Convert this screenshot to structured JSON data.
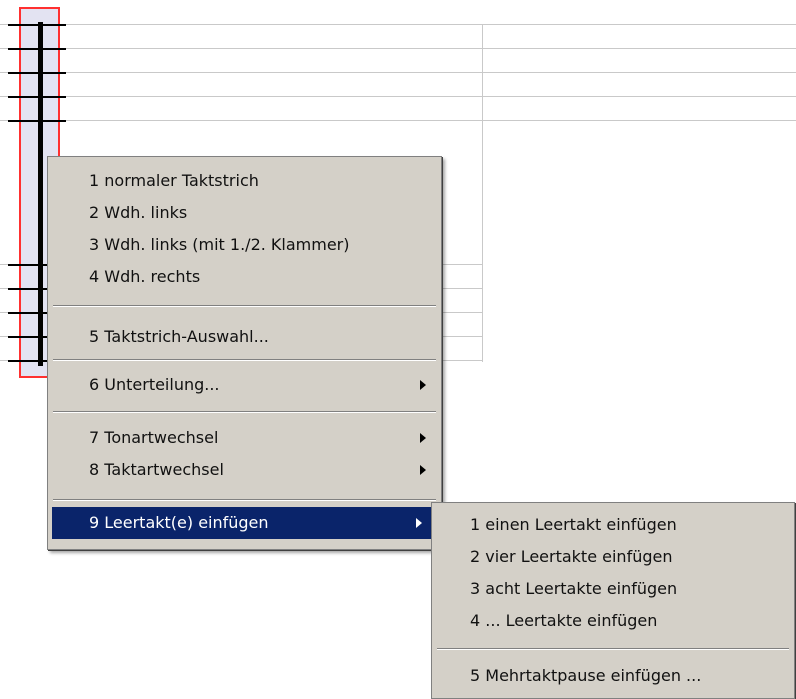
{
  "main_menu": {
    "items": [
      {
        "label": "1 normaler Taktstrich"
      },
      {
        "label": "2 Wdh. links"
      },
      {
        "label": "3 Wdh. links (mit 1./2. Klammer)"
      },
      {
        "label": "4 Wdh. rechts"
      },
      {
        "label": "5 Taktstrich-Auswahl..."
      },
      {
        "label": "6 Unterteilung..."
      },
      {
        "label": "7 Tonartwechsel"
      },
      {
        "label": "8 Taktartwechsel"
      },
      {
        "label": "9 Leertakt(e) einfügen"
      }
    ]
  },
  "submenu": {
    "items": [
      {
        "label": "1 einen Leertakt einfügen"
      },
      {
        "label": "2 vier Leertakte einfügen"
      },
      {
        "label": "3 acht Leertakte einfügen"
      },
      {
        "label": "4 ... Leertakte einfügen"
      },
      {
        "label": "5 Mehrtaktpause einfügen ..."
      }
    ]
  },
  "colors": {
    "menu_bg": "#d4d0c8",
    "highlight": "#0a246a",
    "selection_border": "#ff3030"
  }
}
